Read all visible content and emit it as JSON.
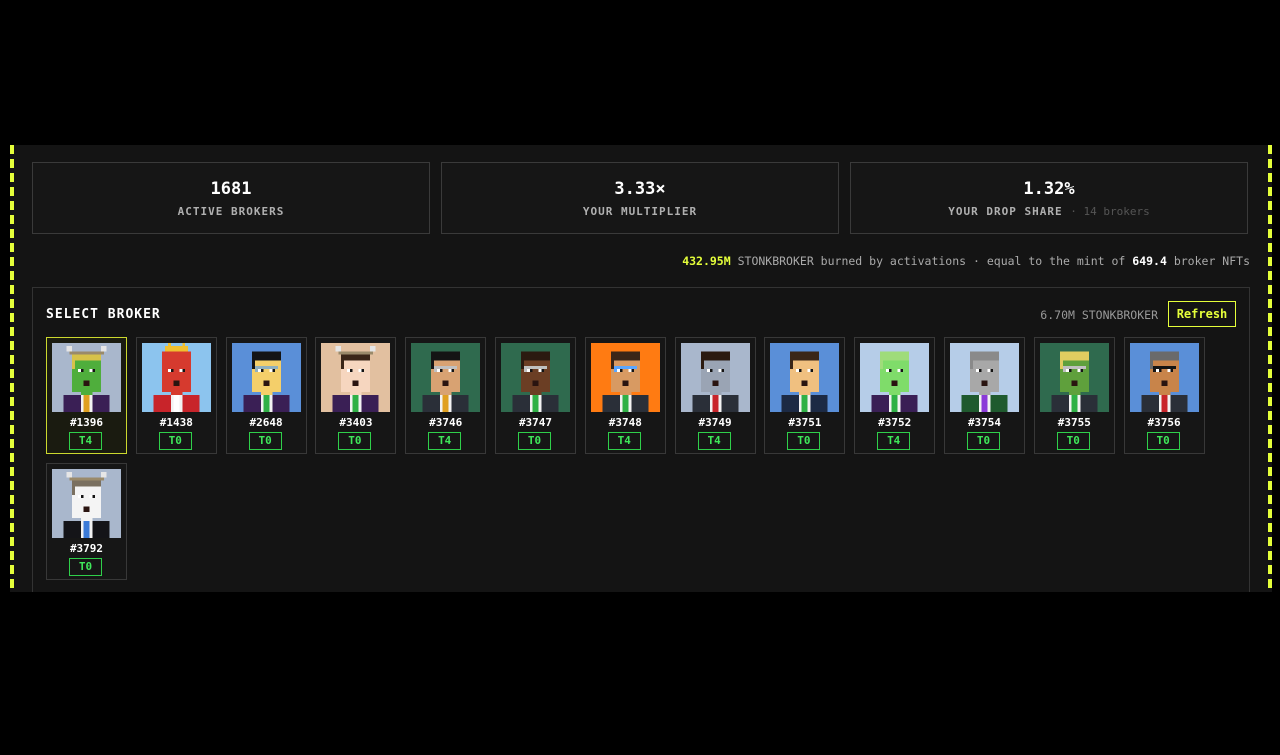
{
  "stats": [
    {
      "value": "1681",
      "label": "ACTIVE BROKERS",
      "sub": ""
    },
    {
      "value": "3.33×",
      "label": "YOUR MULTIPLIER",
      "sub": ""
    },
    {
      "value": "1.32%",
      "label": "YOUR DROP SHARE",
      "sub": "· 14 brokers"
    }
  ],
  "burn": {
    "amount": "432.95M",
    "text1": "STONKBROKER burned by activations · equal to the mint of",
    "nfts": "649.4",
    "text2": "broker NFTs"
  },
  "select": {
    "title": "SELECT BROKER",
    "balance": "6.70M STONKBROKER",
    "refresh_label": "Refresh"
  },
  "brokers": [
    {
      "id": "#1396",
      "tier": "T4",
      "selected": true,
      "bg": "#a9b7cc",
      "skin": "#4fae3c",
      "hair": "#d7c24a",
      "hat": "horns",
      "suit": "#3a1f55",
      "tie": "#e0a020",
      "glasses": ""
    },
    {
      "id": "#1438",
      "tier": "T0",
      "selected": false,
      "bg": "#8cc4ee",
      "skin": "#d63a2e",
      "hair": "#d63a2e",
      "hat": "crown",
      "suit": "#c8242a",
      "tie": "#ffffff",
      "glasses": ""
    },
    {
      "id": "#2648",
      "tier": "T0",
      "selected": false,
      "bg": "#5a8fd8",
      "skin": "#f4cf6a",
      "hair": "#141414",
      "hat": "",
      "suit": "#3a1f55",
      "tie": "#2fb046",
      "glasses": "#8fb0c0"
    },
    {
      "id": "#3403",
      "tier": "T0",
      "selected": false,
      "bg": "#e2c0a0",
      "skin": "#f6d6bf",
      "hair": "#3a2618",
      "hat": "horns",
      "suit": "#3a1f55",
      "tie": "#2fb046",
      "glasses": ""
    },
    {
      "id": "#3746",
      "tier": "T4",
      "selected": false,
      "bg": "#2f6a4e",
      "skin": "#d8a272",
      "hair": "#141414",
      "hat": "",
      "suit": "#2a2f38",
      "tie": "#e0a020",
      "glasses": "#c0c0c0"
    },
    {
      "id": "#3747",
      "tier": "T0",
      "selected": false,
      "bg": "#2f6a4e",
      "skin": "#6b3e24",
      "hair": "#2b1a10",
      "hat": "",
      "suit": "#2a2f38",
      "tie": "#2fb046",
      "glasses": "#c0c0c0"
    },
    {
      "id": "#3748",
      "tier": "T4",
      "selected": false,
      "bg": "#ff7b12",
      "skin": "#d89a62",
      "hair": "#3a2618",
      "hat": "",
      "suit": "#2a2f38",
      "tie": "#2fb046",
      "glasses": "#5aa6ff"
    },
    {
      "id": "#3749",
      "tier": "T4",
      "selected": false,
      "bg": "#a9b7cc",
      "skin": "#9aa4b4",
      "hair": "#2b1a10",
      "hat": "",
      "suit": "#2a2f38",
      "tie": "#c8242a",
      "glasses": ""
    },
    {
      "id": "#3751",
      "tier": "T0",
      "selected": false,
      "bg": "#5a8fd8",
      "skin": "#f0c080",
      "hair": "#3a2618",
      "hat": "",
      "suit": "#1c2a44",
      "tie": "#2fb046",
      "glasses": ""
    },
    {
      "id": "#3752",
      "tier": "T4",
      "selected": false,
      "bg": "#b6cde8",
      "skin": "#7fdc6a",
      "hair": "#9fdc7a",
      "hat": "",
      "suit": "#3a1f55",
      "tie": "#2fb046",
      "glasses": ""
    },
    {
      "id": "#3754",
      "tier": "T0",
      "selected": false,
      "bg": "#b6cde8",
      "skin": "#a8a8a8",
      "hair": "#8a8a8a",
      "hat": "",
      "suit": "#1f5a2e",
      "tie": "#8a3ad8",
      "glasses": ""
    },
    {
      "id": "#3755",
      "tier": "T0",
      "selected": false,
      "bg": "#2f6a4e",
      "skin": "#5fa03c",
      "hair": "#e0cc60",
      "hat": "",
      "suit": "#2a2f38",
      "tie": "#2fb046",
      "glasses": "#c0c0c0"
    },
    {
      "id": "#3756",
      "tier": "T0",
      "selected": false,
      "bg": "#5a8fd8",
      "skin": "#c8844a",
      "hair": "#6a6a6a",
      "hat": "",
      "suit": "#2a2f38",
      "tie": "#c8242a",
      "glasses": "#141414"
    },
    {
      "id": "#3792",
      "tier": "T0",
      "selected": false,
      "bg": "#a9b7cc",
      "skin": "#f4f4f4",
      "hair": "#7a7060",
      "hat": "horns",
      "suit": "#141418",
      "tie": "#3a7ad8",
      "glasses": ""
    }
  ]
}
